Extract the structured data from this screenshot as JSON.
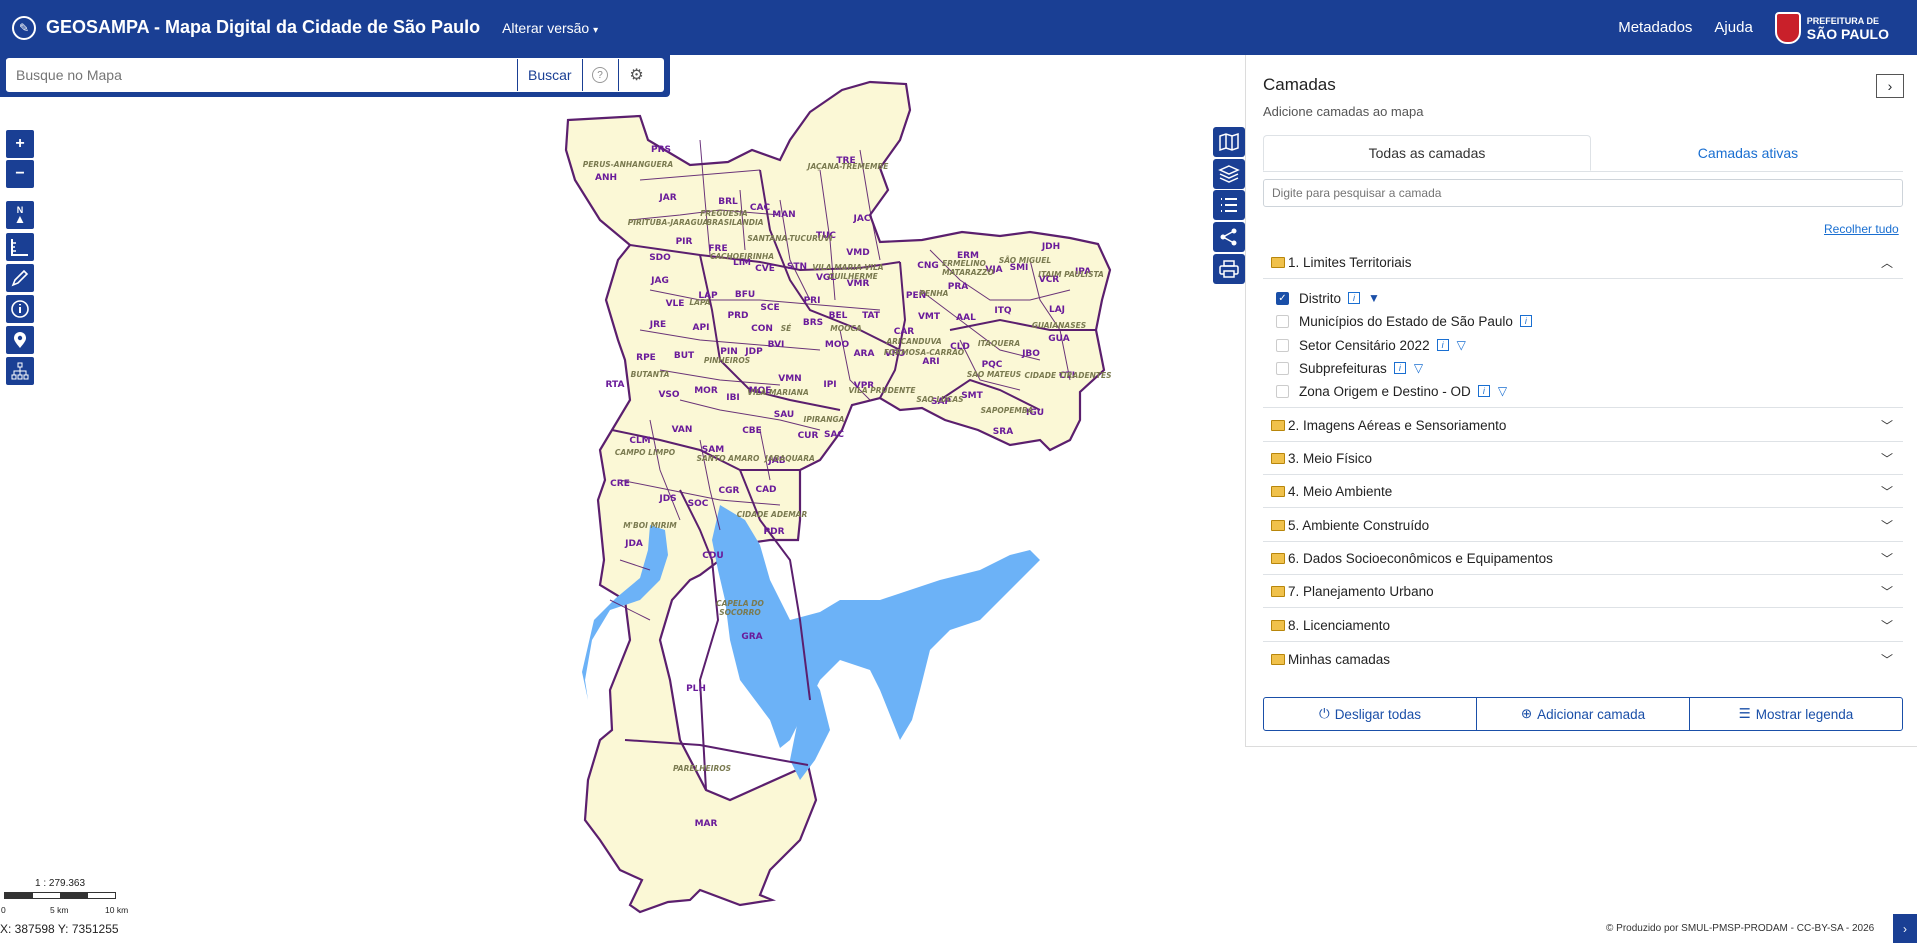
{
  "navbar": {
    "title": "GEOSAMPA - Mapa Digital da Cidade de São Paulo",
    "version_menu": "Alterar versão",
    "links": [
      "Metadados",
      "Ajuda"
    ],
    "prefeitura_line1": "PREFEITURA DE",
    "prefeitura_line2": "SÃO PAULO"
  },
  "search": {
    "placeholder": "Busque no Mapa",
    "button": "Buscar",
    "help_icon": "?",
    "settings_icon": "⚙"
  },
  "left_tools": {
    "zoom_in": "+",
    "zoom_out": "−",
    "north": "N"
  },
  "map": {
    "district_labels": [
      {
        "text": "PRS"
      },
      {
        "text": "ANH"
      },
      {
        "text": "JAR"
      },
      {
        "text": "BRL"
      },
      {
        "text": "CAC"
      },
      {
        "text": "TRE"
      },
      {
        "text": "MAN"
      },
      {
        "text": "JAC"
      },
      {
        "text": "TUC"
      },
      {
        "text": "PIR"
      },
      {
        "text": "FRE"
      },
      {
        "text": "SDO"
      },
      {
        "text": "LIM"
      },
      {
        "text": "CVE"
      },
      {
        "text": "STN"
      },
      {
        "text": "VMD"
      },
      {
        "text": "VGL"
      },
      {
        "text": "VMR"
      },
      {
        "text": "ERM"
      },
      {
        "text": "JDH"
      },
      {
        "text": "CNG"
      },
      {
        "text": "VJA"
      },
      {
        "text": "SMI"
      },
      {
        "text": "IPA"
      },
      {
        "text": "VCR"
      },
      {
        "text": "JAG"
      },
      {
        "text": "PRA"
      },
      {
        "text": "VLE"
      },
      {
        "text": "LAP"
      },
      {
        "text": "BFU"
      },
      {
        "text": "PRI"
      },
      {
        "text": "SCE"
      },
      {
        "text": "PEN"
      },
      {
        "text": "ITQ"
      },
      {
        "text": "LAJ"
      },
      {
        "text": "JRE"
      },
      {
        "text": "API"
      },
      {
        "text": "PRD"
      },
      {
        "text": "BEL"
      },
      {
        "text": "TAT"
      },
      {
        "text": "VMT"
      },
      {
        "text": "AAL"
      },
      {
        "text": "CON"
      },
      {
        "text": "BRS"
      },
      {
        "text": "GUA"
      },
      {
        "text": "CAR"
      },
      {
        "text": "RPE"
      },
      {
        "text": "BUT"
      },
      {
        "text": "PIN"
      },
      {
        "text": "JDP"
      },
      {
        "text": "BVI"
      },
      {
        "text": "MOO"
      },
      {
        "text": "ARA"
      },
      {
        "text": "VFO"
      },
      {
        "text": "CLD"
      },
      {
        "text": "JBO"
      },
      {
        "text": "ARI"
      },
      {
        "text": "PQC"
      },
      {
        "text": "CTI"
      },
      {
        "text": "RTA"
      },
      {
        "text": "VSO"
      },
      {
        "text": "MOR"
      },
      {
        "text": "IBI"
      },
      {
        "text": "VMN"
      },
      {
        "text": "MOE"
      },
      {
        "text": "IPI"
      },
      {
        "text": "VPR"
      },
      {
        "text": "SAP"
      },
      {
        "text": "SMT"
      },
      {
        "text": "IGU"
      },
      {
        "text": "SAU"
      },
      {
        "text": "VAN"
      },
      {
        "text": "CBE"
      },
      {
        "text": "SAC"
      },
      {
        "text": "CUR"
      },
      {
        "text": "SRA"
      },
      {
        "text": "CLM"
      },
      {
        "text": "SAM"
      },
      {
        "text": "JAB"
      },
      {
        "text": "CRE"
      },
      {
        "text": "CGR"
      },
      {
        "text": "CAD"
      },
      {
        "text": "JDS"
      },
      {
        "text": "SOC"
      },
      {
        "text": "PDR"
      },
      {
        "text": "JDA"
      },
      {
        "text": "CDU"
      },
      {
        "text": "GRA"
      },
      {
        "text": "PLH"
      },
      {
        "text": "MAR"
      }
    ],
    "subprefeitura_labels": [
      {
        "text": "PERUS-ANHANGUERA"
      },
      {
        "text": "JAÇANA-TREMEMBE"
      },
      {
        "text": "FREGUESIA"
      },
      {
        "text": "PIRITUBA-JARAGUA"
      },
      {
        "text": "BRASILANDIA"
      },
      {
        "text": "SANTANA-TUCURUVI"
      },
      {
        "text": "CACHOEIRINHA"
      },
      {
        "text": "VILA MARIA-VILA"
      },
      {
        "text": "GUILHERME"
      },
      {
        "text": "ERMELINO"
      },
      {
        "text": "MATARAZZO"
      },
      {
        "text": "SÃO MIGUEL"
      },
      {
        "text": "ITAIM PAULISTA"
      },
      {
        "text": "PENHA"
      },
      {
        "text": "LAPA"
      },
      {
        "text": "MOOCA"
      },
      {
        "text": "ARICANDUVA"
      },
      {
        "text": "FORMOSA-CARRAO"
      },
      {
        "text": "ITAQUERA"
      },
      {
        "text": "GUAIANASES"
      },
      {
        "text": "CIDADE TIRADENTES"
      },
      {
        "text": "SÉ"
      },
      {
        "text": "PINHEIROS"
      },
      {
        "text": "BUTANTA"
      },
      {
        "text": "VILA MARIANA"
      },
      {
        "text": "IPIRANGA"
      },
      {
        "text": "VILA PRUDENTE"
      },
      {
        "text": "SAO MATEUS"
      },
      {
        "text": "SAO LUCAS"
      },
      {
        "text": "SAPOPEMBA"
      },
      {
        "text": "CAMPO LIMPO"
      },
      {
        "text": "SANTO AMARO"
      },
      {
        "text": "JABAQUARA"
      },
      {
        "text": "M'BOI MIRIM"
      },
      {
        "text": "CIDADE ADEMAR"
      },
      {
        "text": "CAPELA DO"
      },
      {
        "text": "SOCORRO"
      },
      {
        "text": "PARELHEIROS"
      }
    ]
  },
  "panel": {
    "title": "Camadas",
    "subtitle": "Adicione camadas ao mapa",
    "collapse_icon": "›",
    "tabs": [
      {
        "label": "Todas as camadas",
        "active": true
      },
      {
        "label": "Camadas ativas",
        "active": false
      }
    ],
    "layer_search_placeholder": "Digite para pesquisar a camada",
    "collapse_all": "Recolher tudo",
    "groups": [
      {
        "label": "1. Limites Territoriais",
        "expanded": true
      },
      {
        "label": "2. Imagens Aéreas e Sensoriamento",
        "expanded": false
      },
      {
        "label": "3. Meio Físico",
        "expanded": false
      },
      {
        "label": "4. Meio Ambiente",
        "expanded": false
      },
      {
        "label": "5. Ambiente Construído",
        "expanded": false
      },
      {
        "label": "6. Dados Socioeconômicos e Equipamentos",
        "expanded": false
      },
      {
        "label": "7. Planejamento Urbano",
        "expanded": false
      },
      {
        "label": "8. Licenciamento",
        "expanded": false
      },
      {
        "label": "Minhas camadas",
        "expanded": false
      }
    ],
    "layers": [
      {
        "label": "Distrito",
        "checked": true,
        "info": true,
        "filter": true
      },
      {
        "label": "Municípios do Estado de São Paulo",
        "checked": false,
        "info": true,
        "filter": false
      },
      {
        "label": "Setor Censitário 2022",
        "checked": false,
        "info": true,
        "filter": true
      },
      {
        "label": "Subprefeituras",
        "checked": false,
        "info": true,
        "filter": true
      },
      {
        "label": "Zona Origem e Destino - OD",
        "checked": false,
        "info": true,
        "filter": true
      }
    ],
    "actions": [
      {
        "label": "Desligar todas",
        "icon": "⏻"
      },
      {
        "label": "Adicionar camada",
        "icon": "⊕"
      },
      {
        "label": "Mostrar legenda",
        "icon": "☰"
      }
    ]
  },
  "footer": {
    "scale_text": "1 : 279.363",
    "scale_labels": [
      "0",
      "5 km",
      "10 km"
    ],
    "coordinates": "X: 387598 Y: 7351255",
    "credits": "© Produzido por SMUL-PMSP-PRODAM - CC-BY-SA - 2026"
  },
  "colors": {
    "brand": "#1a3f94",
    "land": "#fbf8d6",
    "border": "#5b1f6e",
    "water": "#6cb2f7",
    "label": "#6a1b9a"
  }
}
